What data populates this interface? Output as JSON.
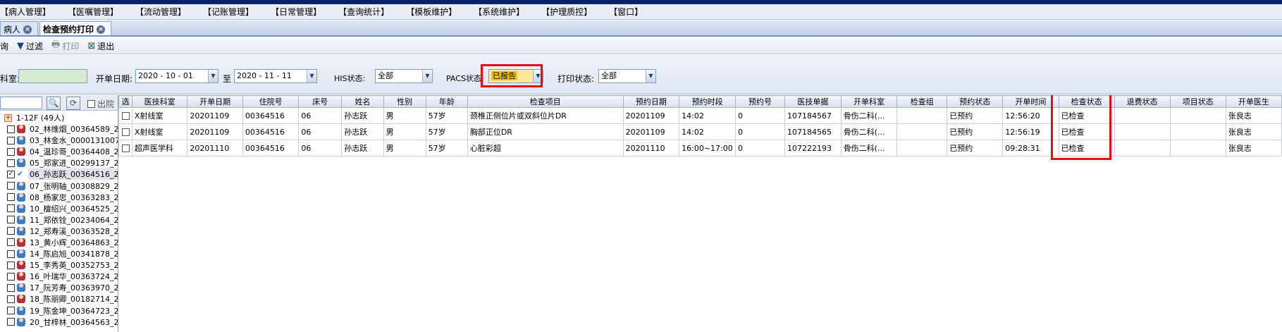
{
  "menu": [
    "【病人管理】",
    "【医嘱管理】",
    "【流动管理】",
    "【记账管理】",
    "【日常管理】",
    "【查询统计】",
    "【模板维护】",
    "【系统维护】",
    "【护理质控】",
    "【窗口】"
  ],
  "tabs": [
    {
      "label": "病人"
    },
    {
      "label": "检查预约打印"
    }
  ],
  "toolbar": {
    "query": "询",
    "filter": "过滤",
    "print": "打印",
    "exit": "退出"
  },
  "filters": {
    "dept_label": "科室:",
    "date_label": "开单日期:",
    "date_from": "2020 - 10 - 01",
    "to_label": "至",
    "date_to": "2020 - 11 - 11",
    "his_label": "HIS状态:",
    "his_value": "全部",
    "pacs_label": "PACS状态:",
    "pacs_value": "已报告",
    "print_label": "打印状态:",
    "print_value": "全部"
  },
  "left_panel": {
    "out_label": "出院",
    "group": "1-12F (49人)",
    "patients": [
      {
        "text": "02_林维烟_00364589_2",
        "g": "f",
        "checked": false
      },
      {
        "text": "03_林金水_0000131007",
        "g": "m",
        "checked": false
      },
      {
        "text": "04_温珍哥_00364408_2",
        "g": "f",
        "checked": false
      },
      {
        "text": "05_郑家进_00299137_2",
        "g": "m",
        "checked": false
      },
      {
        "text": "06_孙志跃_00364516_2",
        "g": "c",
        "checked": true
      },
      {
        "text": "07_张明轴_00308829_2",
        "g": "m",
        "checked": false
      },
      {
        "text": "08_杨家忠_00363283_2",
        "g": "m",
        "checked": false
      },
      {
        "text": "10_檀绍兴_00364525_2",
        "g": "m",
        "checked": false
      },
      {
        "text": "11_郑依铨_00234064_2",
        "g": "m",
        "checked": false
      },
      {
        "text": "12_郑寿溪_00363528_2",
        "g": "m",
        "checked": false
      },
      {
        "text": "13_黄小辉_00364863_2",
        "g": "f",
        "checked": false
      },
      {
        "text": "14_陈启旭_00341878_2",
        "g": "m",
        "checked": false
      },
      {
        "text": "15_李秀英_00352753_2",
        "g": "f",
        "checked": false
      },
      {
        "text": "16_叶瑞华_00363724_2",
        "g": "f",
        "checked": false
      },
      {
        "text": "17_阮芳寿_00363970_2",
        "g": "m",
        "checked": false
      },
      {
        "text": "18_陈丽卿_00182714_2",
        "g": "f",
        "checked": false
      },
      {
        "text": "19_陈金坤_00364723_2",
        "g": "m",
        "checked": false
      },
      {
        "text": "20_甘梓林_00364563_2",
        "g": "m",
        "checked": false
      }
    ]
  },
  "grid": {
    "columns": [
      "选",
      "医技科室",
      "开单日期",
      "住院号",
      "床号",
      "姓名",
      "性别",
      "年龄",
      "检查项目",
      "预约日期",
      "预约时段",
      "预约号",
      "医技单据",
      "开单科室",
      "检查组",
      "预约状态",
      "开单时间",
      "检查状态",
      "退费状态",
      "项目状态",
      "开单医生"
    ],
    "rows": [
      [
        "",
        "X射线室",
        "20201109",
        "00364516",
        "06",
        "孙志跃",
        "男",
        "57岁",
        "颈椎正侧位片或双斜位片DR",
        "20201109",
        "14:02",
        "0",
        "107184567",
        "骨伤二科(...",
        "",
        "已预约",
        "12:56:20",
        "已检查",
        "",
        "",
        "张良志"
      ],
      [
        "",
        "X射线室",
        "20201109",
        "00364516",
        "06",
        "孙志跃",
        "男",
        "57岁",
        "胸部正位DR",
        "20201109",
        "14:02",
        "0",
        "107184565",
        "骨伤二科(...",
        "",
        "已预约",
        "12:56:19",
        "已检查",
        "",
        "",
        "张良志"
      ],
      [
        "",
        "超声医学科",
        "20201110",
        "00364516",
        "06",
        "孙志跃",
        "男",
        "57岁",
        "心脏彩超",
        "20201110",
        "16:00~17:00",
        "0",
        "107222193",
        "骨伤二科(...",
        "",
        "已预约",
        "09:28:31",
        "已检查",
        "",
        "",
        "张良志"
      ]
    ]
  },
  "colors": {
    "highlight": "#e0101a",
    "accent": "#6f93cf"
  }
}
